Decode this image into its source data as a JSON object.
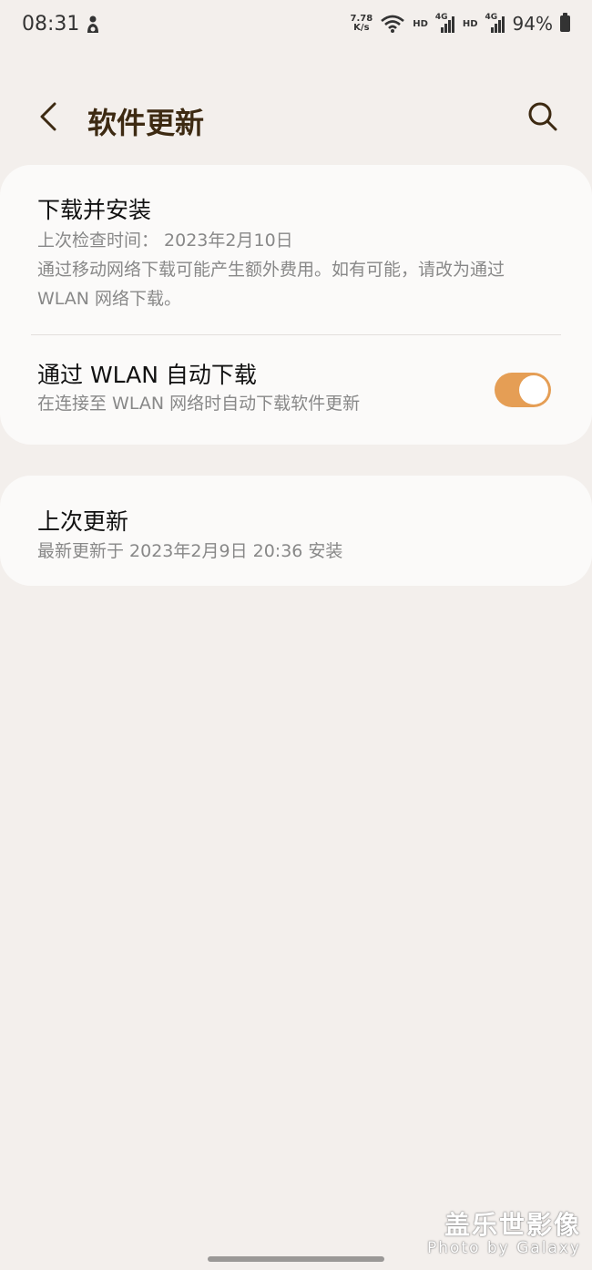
{
  "status_bar": {
    "time": "08:31",
    "net_speed_value": "7.78",
    "net_speed_unit": "K/s",
    "hd1": "HD",
    "hd2": "HD",
    "sig_label1": "4G",
    "sig_label2": "4G",
    "battery": "94%"
  },
  "header": {
    "title": "软件更新"
  },
  "download_install": {
    "title": "下载并安装",
    "last_check": "上次检查时间： 2023年2月10日",
    "note_line1": "通过移动网络下载可能产生额外费用。如有可能，请改为通过",
    "note_line2": "WLAN 网络下载。"
  },
  "auto_download": {
    "title": "通过 WLAN 自动下载",
    "subtitle": "在连接至 WLAN 网络时自动下载软件更新",
    "enabled": true,
    "accent_color": "#e59e55"
  },
  "last_update": {
    "title": "上次更新",
    "subtitle": "最新更新于 2023年2月9日 20:36 安装"
  },
  "watermark": {
    "cn": "盖乐世影像",
    "en": "Photo by Galaxy"
  },
  "icons": {
    "back": "chevron-left-icon",
    "search": "search-icon",
    "wifi": "wifi-icon",
    "signal": "signal-icon",
    "battery": "battery-icon"
  }
}
